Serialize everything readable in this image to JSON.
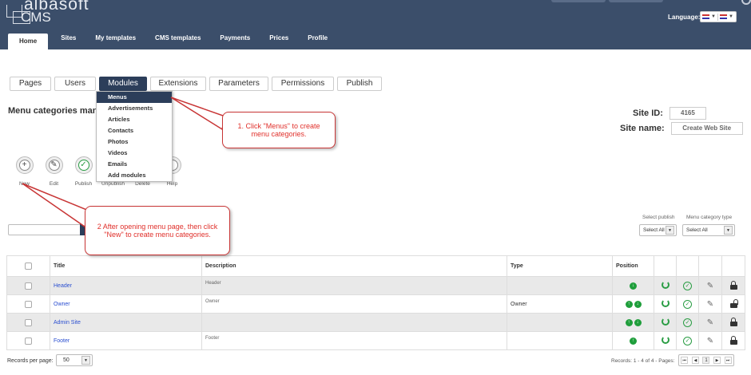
{
  "header": {
    "logo_name": "albasoft",
    "logo_product": "CMS",
    "language_label": "Language:",
    "nav_tabs": [
      "Home",
      "Sites",
      "My templates",
      "CMS templates",
      "Payments",
      "Prices",
      "Profile"
    ]
  },
  "module_tabs": [
    "Pages",
    "Users",
    "Modules",
    "Extensions",
    "Parameters",
    "Permissions",
    "Publish"
  ],
  "modules_menu": [
    "Menus",
    "Advertisements",
    "Articles",
    "Contacts",
    "Photos",
    "Videos",
    "Emails",
    "Add modules"
  ],
  "page_title": "Menu categories mana",
  "site": {
    "id_label": "Site ID:",
    "id_value": "4165",
    "name_label": "Site name:",
    "name_value": "Create Web Site"
  },
  "toolbar": [
    "New",
    "Edit",
    "Publish",
    "Unpublish",
    "Delete",
    "Help"
  ],
  "filters": {
    "publish_label": "Select publish",
    "publish_value": "Select All",
    "type_label": "Menu category type",
    "type_value": "Select All"
  },
  "table": {
    "columns": [
      "Title",
      "Description",
      "Type",
      "Position"
    ],
    "rows": [
      {
        "title": "Header",
        "description": "Header",
        "type": "",
        "positions": [
          "↓"
        ]
      },
      {
        "title": "Owner",
        "description": "Owner",
        "type": "Owner",
        "positions": [
          "↑",
          "↓"
        ]
      },
      {
        "title": "Admin Site",
        "description": "",
        "type": "",
        "positions": [
          "↑",
          "↓"
        ]
      },
      {
        "title": "Footer",
        "description": "Footer",
        "type": "",
        "positions": [
          "↑"
        ]
      }
    ]
  },
  "footer": {
    "records_per_page_label": "Records per page:",
    "records_per_page_value": "50",
    "records_summary": "Records: 1 - 4 of 4 - Pages:",
    "current_page": "1"
  },
  "callouts": {
    "step1_line1": "1. Click \"Menus\" to create",
    "step1_line2": "menu categories.",
    "step2_line1": "2  After opening menu page, then click",
    "step2_line2": "\"New\" to create menu categories."
  },
  "icons": {
    "move_up": "arrow-up-icon",
    "move_down": "arrow-down-icon",
    "refresh": "refresh-icon",
    "published": "check-circle-icon",
    "edit": "pencil-icon",
    "lock": "lock-icon"
  },
  "colors": {
    "header_bg": "#3b4e6a",
    "active_tab": "#2c3e5a",
    "link": "#2a4ed0",
    "callout": "#e0302b",
    "position_green": "#1f9e3b"
  }
}
